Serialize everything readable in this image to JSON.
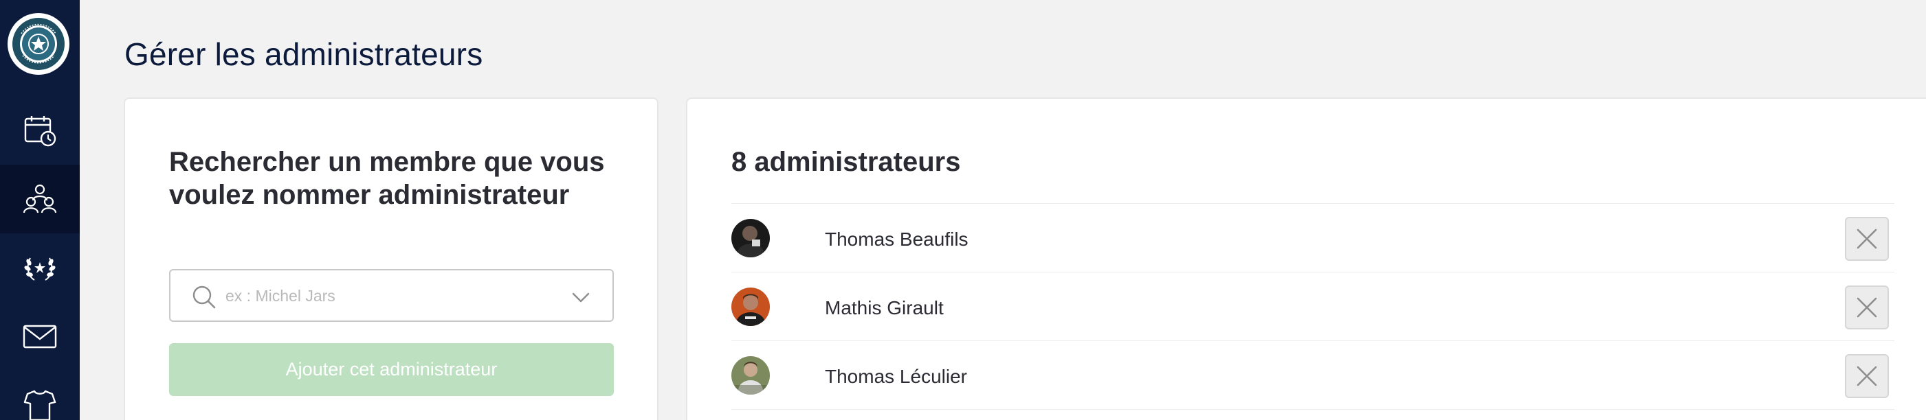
{
  "sidebar": {
    "logo_icon": "club-crest-logo",
    "items": [
      {
        "icon": "calendar-clock-icon",
        "active": false
      },
      {
        "icon": "users-group-icon",
        "active": true
      },
      {
        "icon": "laurel-wreath-icon",
        "active": false
      },
      {
        "icon": "envelope-icon",
        "active": false
      },
      {
        "icon": "jersey-icon",
        "active": false
      }
    ]
  },
  "page": {
    "title": "Gérer les administrateurs"
  },
  "search_panel": {
    "heading": "Rechercher un membre que vous voulez nommer administrateur",
    "search_placeholder": "ex : Michel Jars",
    "search_value": "",
    "add_button_label": "Ajouter cet administrateur"
  },
  "admins_panel": {
    "count_label": "8 administrateurs",
    "admins": [
      {
        "name": "Thomas Beaufils"
      },
      {
        "name": "Mathis Girault"
      },
      {
        "name": "Thomas Léculier"
      }
    ]
  },
  "colors": {
    "sidebar_bg": "#0c1a3c",
    "sidebar_active_bg": "#07112b",
    "page_bg": "#f2f2f2",
    "add_button_disabled": "#bde0c1",
    "title_color": "#0c1a3c"
  }
}
